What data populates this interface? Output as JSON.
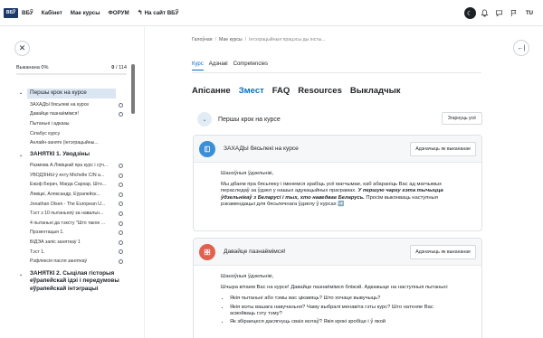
{
  "topbar": {
    "logo": "ВБЎ",
    "nav": [
      "ВБЎ",
      "Кабінет",
      "Мае курсы",
      "ФОРУМ"
    ],
    "back_link": "На сайт ВБЎ",
    "avatar_initials": "TU"
  },
  "sidebar": {
    "progress_label": "Выканана 0%",
    "progress_count_done": "0",
    "progress_count_total": "/ 114",
    "progress_fraction": 0,
    "sections": [
      {
        "title": "Першы крок на курсе",
        "highlighted": true,
        "items": [
          {
            "label": "ЗАХАДЫ бясьпекі на курсе",
            "circle": true
          },
          {
            "label": "Давайце пазнаёмімся!",
            "circle": true
          },
          {
            "label": "Пытаньні і адказы",
            "circle": false
          },
          {
            "label": "Сілабус курсу",
            "circle": false
          },
          {
            "label": "Анлайн-занятк (інтэграцыйны...",
            "circle": false
          }
        ]
      },
      {
        "title": "ЗАНЯТКІ 1. Уводзіны",
        "highlighted": false,
        "items": [
          {
            "label": "Размова А.Лявіцкай пра курс і сўч...",
            "circle": true
          },
          {
            "label": "УВОДЗІНЫ ў ехту Michelle CIN а...",
            "circle": true
          },
          {
            "label": "Ёжэф Берач, Магда Сархар, Што...",
            "circle": true
          },
          {
            "label": "Лявіцкі, Аляксандр, Еўрапейск...",
            "circle": true
          },
          {
            "label": "Jonathan Olsen - The European U...",
            "circle": true
          },
          {
            "label": "Тэст з 10 пытаньняў за навальн...",
            "circle": true
          },
          {
            "label": "4 пытаньні да тэксту \"Што такое ...",
            "circle": true
          },
          {
            "label": "Прэзентацыя 1.",
            "circle": true
          },
          {
            "label": "ВІДЭА запіс заняткаў 1",
            "circle": true
          },
          {
            "label": "Тэст 1.",
            "circle": true
          },
          {
            "label": "Рэфлексія пасля заняткаў",
            "circle": true
          }
        ]
      },
      {
        "title": "ЗАНЯТКІ 2. Сыцілая гісторыя еўрапейскай ідэі і передумовы еўрапейскай інтэграцыі",
        "highlighted": false,
        "items": []
      }
    ]
  },
  "main": {
    "breadcrumb": [
      "Галоўная",
      "Мае курсы",
      "Інтэграцыйныя працэсы ды інсты..."
    ],
    "subtabs": [
      "Курс",
      "Адзнакі",
      "Competencies"
    ],
    "tabs": [
      "Апісанне",
      "Змест",
      "FAQ",
      "Resources",
      "Выкладчык"
    ],
    "section_title": "Першы крок на курсе",
    "collapse_all_label": "Згарнуць усё",
    "cards": [
      {
        "title": "ЗАХАДЫ бясьпекі на курсе",
        "icon": "book-icon",
        "icon_color": "#3a8fd6",
        "mark_label": "Адзначыць як выкананае",
        "greeting": "Шаноўныя ўдзельнікі,",
        "para_start": "Мы дбаем пра бясьпеку і імкнемся зрабіць усё магчымае, каб абараніць Вас ад магчымых пераследаў за ўдзел у нашых адукацыйных праграмах.",
        "para_emph": "У першую чаргу гэта тычыцца ўдзельнікаў з Беларусі і тых, хто наведвае Беларусь.",
        "para_end": "Просім выконваць наступныя рэкамендацыі для бясьпечнага ўдзелу ў курсах ➡️"
      },
      {
        "title": "Давайце пазнаёмімся!",
        "icon": "forum-icon",
        "icon_color": "#e0614f",
        "mark_label": "Адзначыць як выкананае",
        "greeting": "Шаноўныя ўдзельнікі,",
        "intro": "Шчыра вітаем Вас на курсе! Давайце пазнаёмімся бліжэй. Адкажыце на наступныя пытаньні:",
        "questions": [
          "Якія пытаньні або тэмы вас цікавяць? Што хочаце вывучыць?",
          "Якія мэты вашага навучаньня? Чаму выбралі менавіта гэты курс? Што натхняе Вас асвойваць гэту тэму?",
          "Як збіраецеся дасягнуць сваіх мэтаў? Якія крокі зробіце і ў якой"
        ]
      }
    ]
  }
}
